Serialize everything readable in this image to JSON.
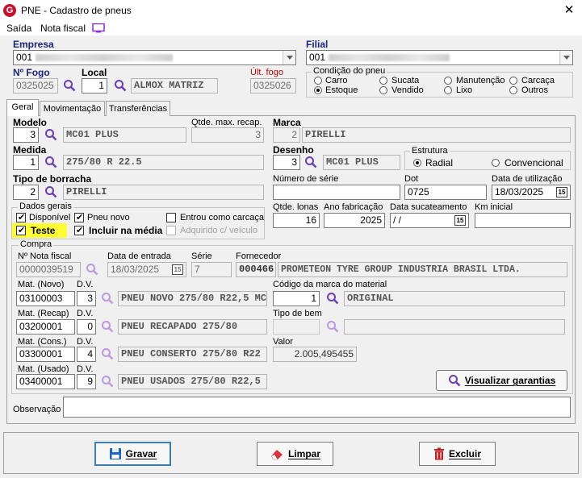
{
  "window": {
    "title": "PNE - Cadastro de pneus",
    "close": "✕"
  },
  "menu": [
    "Saída",
    "Nota fiscal"
  ],
  "header": {
    "empresa_label": "Empresa",
    "empresa_value": "001",
    "filial_label": "Filial",
    "filial_value": "001",
    "fogo_label": "Nº Fogo",
    "fogo_value": "0325025",
    "local_label": "Local",
    "local_code": "1",
    "local_name": "ALMOX MATRIZ",
    "ult_fogo_label": "Últ. fogo",
    "ult_fogo_value": "0325026"
  },
  "condicao": {
    "title": "Condição do pneu",
    "options": [
      "Carro",
      "Sucata",
      "Manutenção",
      "Carcaça",
      "Estoque",
      "Vendido",
      "Lixo",
      "Outros"
    ],
    "selected": "Estoque"
  },
  "tabs": [
    "Geral",
    "Movimentação",
    "Transferências"
  ],
  "geral": {
    "modelo_label": "Modelo",
    "modelo_code": "3",
    "modelo_name": "MC01 PLUS",
    "qtde_max_label": "Qtde. max. recap.",
    "qtde_max_value": "3",
    "marca_label": "Marca",
    "marca_code": "2",
    "marca_name": "PIRELLI",
    "medida_label": "Medida",
    "medida_code": "1",
    "medida_name": "275/80 R 22.5",
    "desenho_label": "Desenho",
    "desenho_code": "3",
    "desenho_name": "MC01 PLUS",
    "estrutura_title": "Estrutura",
    "estrutura_radial": "Radial",
    "estrutura_convencional": "Convencional",
    "tipo_borracha_label": "Tipo de borracha",
    "tipo_borracha_code": "2",
    "tipo_borracha_name": "PIRELLI",
    "num_serie_label": "Número de série",
    "num_serie_value": "",
    "dot_label": "Dot",
    "dot_value": "0725",
    "data_util_label": "Data de utilização",
    "data_util_value": "18/03/2025",
    "dados_gerais_title": "Dados gerais",
    "chk_disponivel": "Disponível",
    "chk_pneu_novo": "Pneu novo",
    "chk_entrou_carcaca": "Entrou como carcaça",
    "chk_teste": "Teste",
    "chk_incluir_media": "Incluir na média",
    "chk_adquirido": "Adquirido c/ veículo",
    "qtde_lonas_label": "Qtde. lonas",
    "qtde_lonas_value": "16",
    "ano_fab_label": "Ano fabricação",
    "ano_fab_value": "2025",
    "data_sucat_label": "Data sucateamento",
    "data_sucat_value": " / /",
    "km_inicial_label": "Km inicial",
    "km_inicial_value": ""
  },
  "compra": {
    "title": "Compra",
    "nf_label": "Nº Nota fiscal",
    "nf_value": "0000039519",
    "data_entrada_label": "Data de entrada",
    "data_entrada_value": "18/03/2025",
    "serie_label": "Série",
    "serie_value": "7",
    "fornecedor_label": "Fornecedor",
    "fornecedor_code": "000466",
    "fornecedor_name": "PROMETEON TYRE GROUP INDUSTRIA BRASIL LTDA.",
    "dv_label": "D.V.",
    "mat_novo_label": "Mat. (Novo)",
    "mat_novo_value": "03100003",
    "mat_novo_dv": "3",
    "mat_novo_desc": "PNEU NOVO 275/80 R22,5  MC",
    "cod_marca_label": "Código da marca do material",
    "cod_marca_code": "1",
    "cod_marca_name": "ORIGINAL",
    "mat_recap_label": "Mat. (Recap)",
    "mat_recap_value": "03200001",
    "mat_recap_dv": "0",
    "mat_recap_desc": "PNEU RECAPADO 275/80",
    "tipo_bem_label": "Tipo de bem",
    "mat_cons_label": "Mat. (Cons.)",
    "mat_cons_value": "03300001",
    "mat_cons_dv": "4",
    "mat_cons_desc": "PNEU CONSERTO 275/80 R22",
    "valor_label": "Valor",
    "valor_value": "2.005,495455",
    "mat_usado_label": "Mat. (Usado)",
    "mat_usado_value": "03400001",
    "mat_usado_dv": "9",
    "mat_usado_desc": "PNEU USADOS 275/80 R22,5",
    "visualizar_label": "Visualizar garantias"
  },
  "observacao_label": "Observação",
  "buttons": {
    "gravar": "Gravar",
    "limpar": "Limpar",
    "excluir": "Excluir"
  },
  "calendar_glyph": "15",
  "colors": {
    "accent_red": "#c00000",
    "highlight": "#ffff33",
    "icon_purple": "#6a3fb5"
  }
}
